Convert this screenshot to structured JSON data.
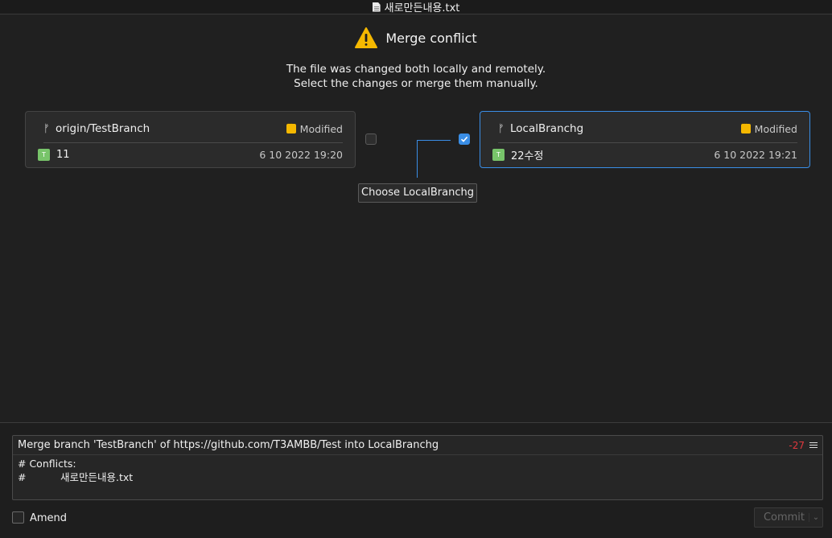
{
  "window": {
    "title": "새로만든내용.txt"
  },
  "header": {
    "title": "Merge conflict"
  },
  "description": {
    "line1": "The file was changed both locally and remotely.",
    "line2": "Select the changes or merge them manually."
  },
  "remote": {
    "branch": "origin/TestBranch",
    "status": "Modified",
    "commit_badge": "T",
    "commit_message": "11",
    "commit_date": "6 10 2022 19:20",
    "selected": false
  },
  "local": {
    "branch": "LocalBranchg",
    "status": "Modified",
    "commit_badge": "T",
    "commit_message": "22수정",
    "commit_date": "6 10 2022 19:21",
    "selected": true
  },
  "tooltip": {
    "text": "Choose LocalBranchg"
  },
  "commit_message": {
    "title": "Merge branch 'TestBranch' of https://github.com/T3AMBB/Test into LocalBranchg",
    "char_count": "-27",
    "body_line1": "# Conflicts:",
    "body_line2_hash": "#",
    "body_line2_file": "새로만든내용.txt"
  },
  "amend": {
    "label": "Amend",
    "checked": false
  },
  "commit_button": {
    "label": "Commit",
    "enabled": false
  },
  "colors": {
    "accent": "#3a8ee6",
    "warning": "#f5b800",
    "error": "#e0383e",
    "badge_green": "#78c46a"
  }
}
